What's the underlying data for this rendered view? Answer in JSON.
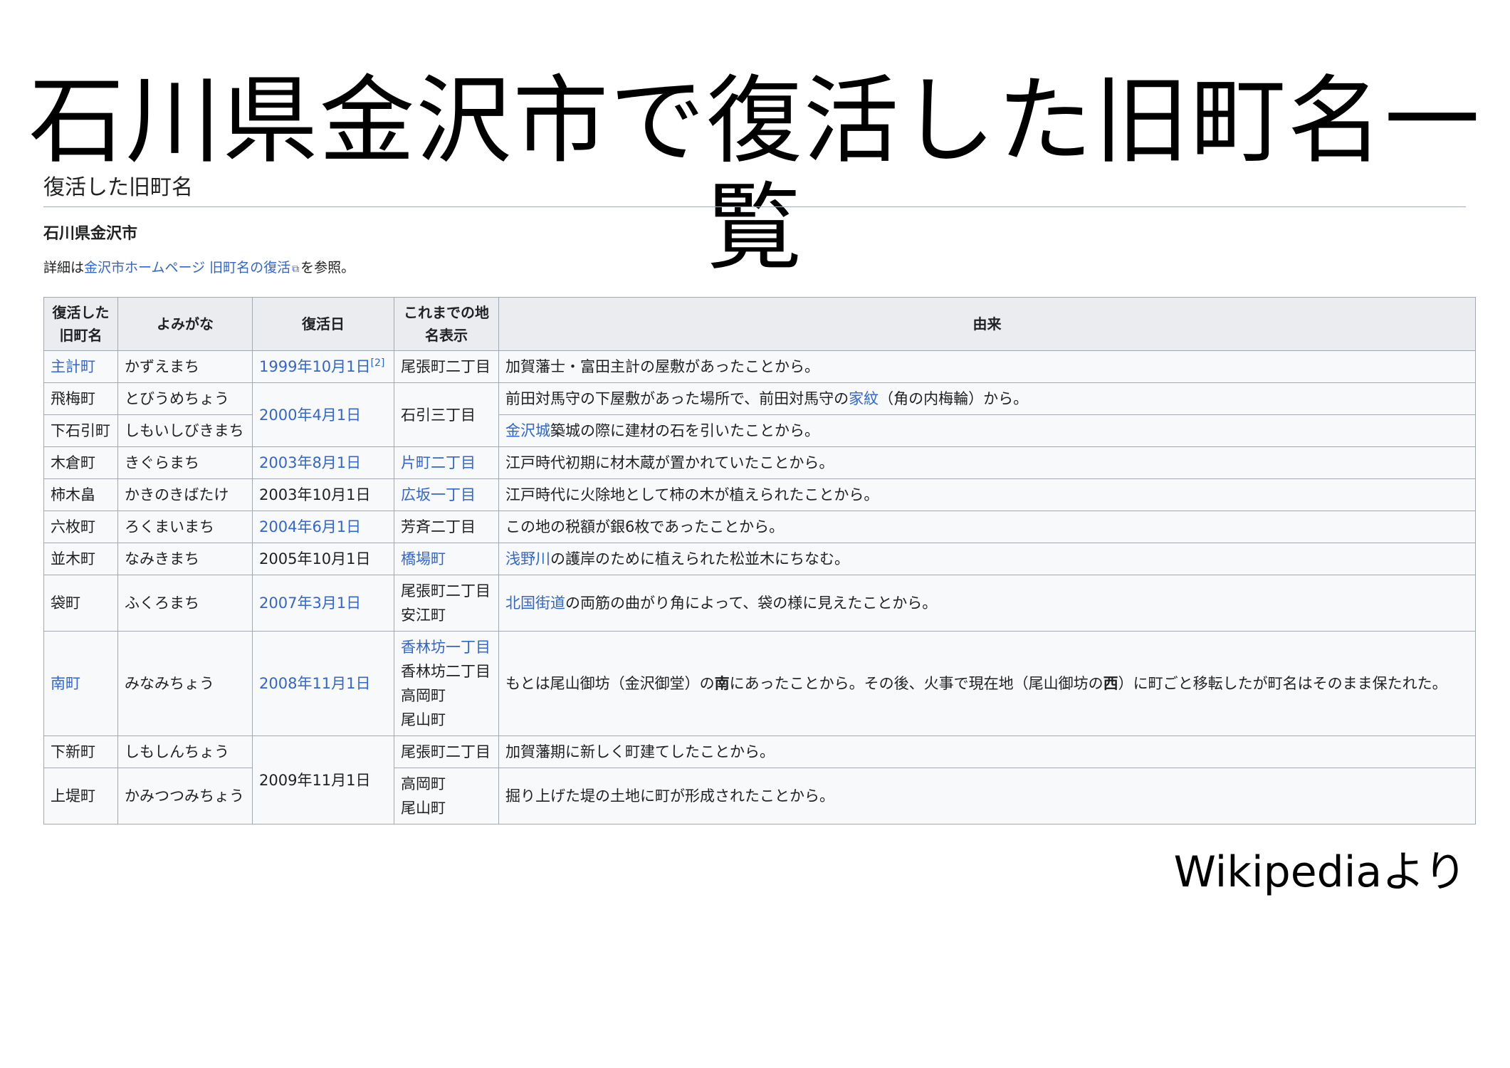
{
  "slide_title": "石川県金沢市で復活した旧町名一覧",
  "section_heading": "復活した旧町名",
  "sub_heading": "石川県金沢市",
  "note": {
    "prefix": "詳細は",
    "link": "金沢市ホームページ 旧町名の復活",
    "suffix": "を参照。"
  },
  "table": {
    "headers": [
      "復活した旧町名",
      "よみがな",
      "復活日",
      "これまでの地名表示",
      "由来"
    ],
    "rows": {
      "r0": {
        "name": "主計町",
        "yomi": "かずえまち",
        "date": "1999年10月1日",
        "ref": "[2]",
        "prev": "尾張町二丁目",
        "origin": "加賀藩士・富田主計の屋敷があったことから。"
      },
      "r1": {
        "name": "飛梅町",
        "yomi": "とびうめちょう",
        "date": "2000年4月1日",
        "prev": "石引三丁目",
        "origin_a": "前田対馬守の下屋敷があった場所で、前田対馬守の",
        "origin_link": "家紋",
        "origin_b": "（角の内梅輪）から。"
      },
      "r2": {
        "name": "下石引町",
        "yomi": "しもいしびきまち",
        "origin_link": "金沢城",
        "origin_b": "築城の際に建材の石を引いたことから。"
      },
      "r3": {
        "name": "木倉町",
        "yomi": "きぐらまち",
        "date": "2003年8月1日",
        "prev": "片町二丁目",
        "origin": "江戸時代初期に材木蔵が置かれていたことから。"
      },
      "r4": {
        "name": "柿木畠",
        "yomi": "かきのきばたけ",
        "date": "2003年10月1日",
        "prev": "広坂一丁目",
        "origin": "江戸時代に火除地として柿の木が植えられたことから。"
      },
      "r5": {
        "name": "六枚町",
        "yomi": "ろくまいまち",
        "date": "2004年6月1日",
        "prev": "芳斉二丁目",
        "origin": "この地の税額が銀6枚であったことから。"
      },
      "r6": {
        "name": "並木町",
        "yomi": "なみきまち",
        "date": "2005年10月1日",
        "prev": "橋場町",
        "origin_link": "浅野川",
        "origin_b": "の護岸のために植えられた松並木にちなむ。"
      },
      "r7": {
        "name": "袋町",
        "yomi": "ふくろまち",
        "date": "2007年3月1日",
        "prev_1": "尾張町二丁目",
        "prev_2": "安江町",
        "origin_link": "北国街道",
        "origin_b": "の両筋の曲がり角によって、袋の様に見えたことから。"
      },
      "r8": {
        "name": "南町",
        "yomi": "みなみちょう",
        "date": "2008年11月1日",
        "prev_1": "香林坊一丁目",
        "prev_2": "香林坊二丁目",
        "prev_3": "高岡町",
        "prev_4": "尾山町",
        "origin_a": "もとは尾山御坊（金沢御堂）の",
        "origin_bold1": "南",
        "origin_b": "にあったことから。その後、火事で現在地（尾山御坊の",
        "origin_bold2": "西",
        "origin_c": "）に町ごと移転したが町名はそのまま保たれた。"
      },
      "r9": {
        "name": "下新町",
        "yomi": "しもしんちょう",
        "date": "2009年11月1日",
        "prev": "尾張町二丁目",
        "origin": "加賀藩期に新しく町建てしたことから。"
      },
      "r10": {
        "name": "上堤町",
        "yomi": "かみつつみちょう",
        "prev_1": "高岡町",
        "prev_2": "尾山町",
        "origin": "掘り上げた堤の土地に町が形成されたことから。"
      }
    }
  },
  "source": "Wikipediaより"
}
